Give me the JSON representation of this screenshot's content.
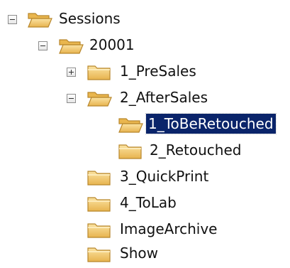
{
  "tree": {
    "nodes": [
      {
        "label": "Sessions",
        "expanded": true,
        "icon": "folder-open-icon"
      },
      {
        "label": "20001",
        "expanded": true,
        "icon": "folder-open-icon"
      },
      {
        "label": "1_PreSales",
        "expanded": false,
        "icon": "folder-icon"
      },
      {
        "label": "2_AfterSales",
        "expanded": true,
        "icon": "folder-open-icon"
      },
      {
        "label": "1_ToBeRetouched",
        "selected": true,
        "icon": "folder-open-icon"
      },
      {
        "label": "2_Retouched",
        "icon": "folder-icon"
      },
      {
        "label": "3_QuickPrint",
        "icon": "folder-icon"
      },
      {
        "label": "4_ToLab",
        "icon": "folder-icon"
      },
      {
        "label": "ImageArchive",
        "icon": "folder-icon"
      },
      {
        "label": "Show",
        "icon": "folder-icon"
      }
    ]
  },
  "colors": {
    "selection_bg": "#0a246a",
    "selection_text": "#ffffff",
    "folder_fill": "#f3c86a",
    "folder_edge": "#b8862b"
  }
}
